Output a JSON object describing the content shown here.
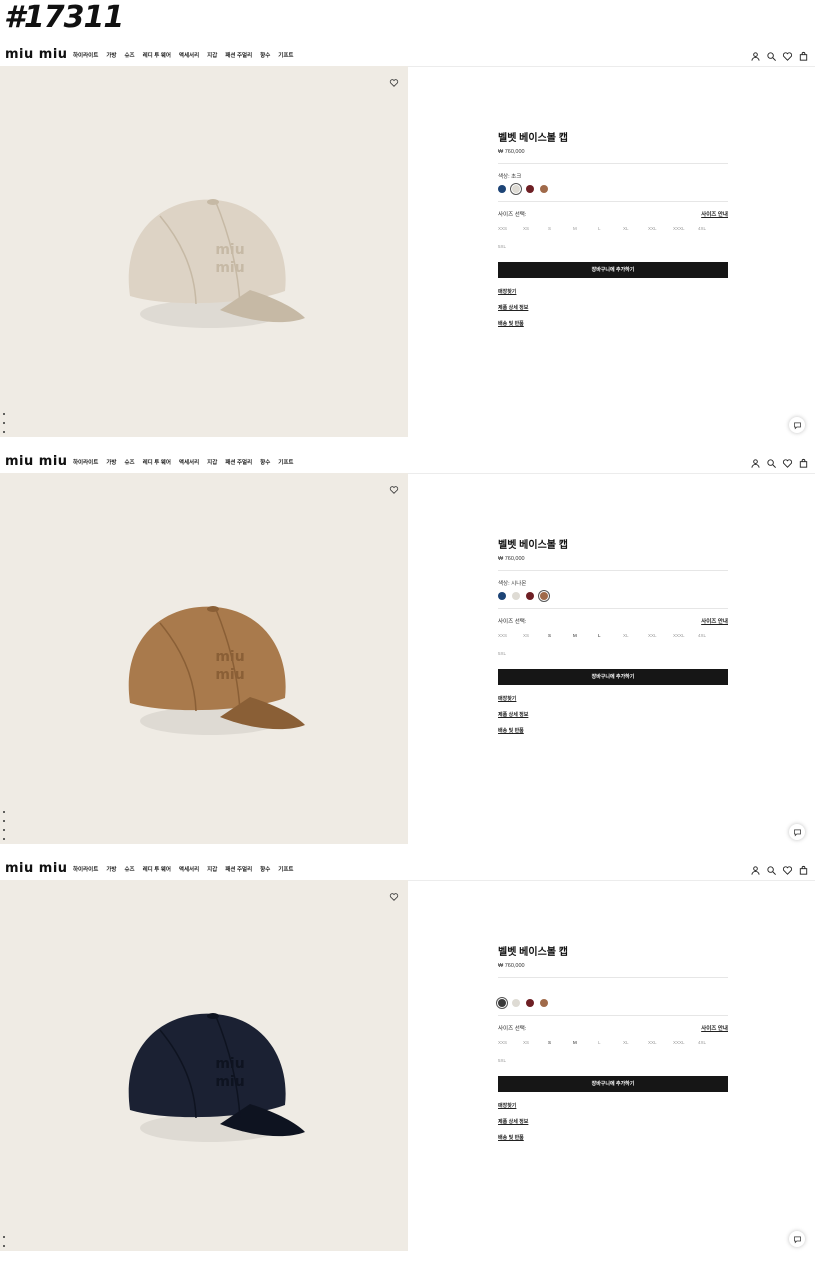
{
  "page_id": "#17311",
  "brand": "miu miu",
  "nav": [
    "하이라이트",
    "가방",
    "슈즈",
    "레디 투 웨어",
    "액세서리",
    "지갑",
    "패션 주얼리",
    "향수",
    "기프트"
  ],
  "product": {
    "title": "벨벳 베이스볼 캡",
    "price": "₩ 760,000",
    "color_prefix": "색상:",
    "size_label": "사이즈 선택:",
    "size_guide": "사이즈 안내",
    "sizes": [
      "XXS",
      "XS",
      "S",
      "M",
      "L",
      "XL",
      "XXL",
      "XXXL",
      "4XL",
      "5XL"
    ],
    "add_to_cart": "장바구니에 추가하기",
    "links": [
      "매장찾기",
      "제품 상세 정보",
      "배송 및 반품"
    ]
  },
  "swatch_colors": [
    "#1d4476",
    "#dedbd4",
    "#6e1f24",
    "#a06a4a"
  ],
  "panels": [
    {
      "color_name": "초크",
      "cap_color": "#ddd3c5",
      "cap_shade": "#c6b9a5",
      "selected": 1,
      "dots": 3
    },
    {
      "color_name": "시나몬",
      "cap_color": "#a97a4c",
      "cap_shade": "#8a5f36",
      "selected": 3,
      "dots": 4
    },
    {
      "color_name": "",
      "cap_color": "#1b2133",
      "cap_shade": "#0e1320",
      "selected": 0,
      "dots": 2
    }
  ],
  "panel3_first_swatch": "#3a3a3a"
}
